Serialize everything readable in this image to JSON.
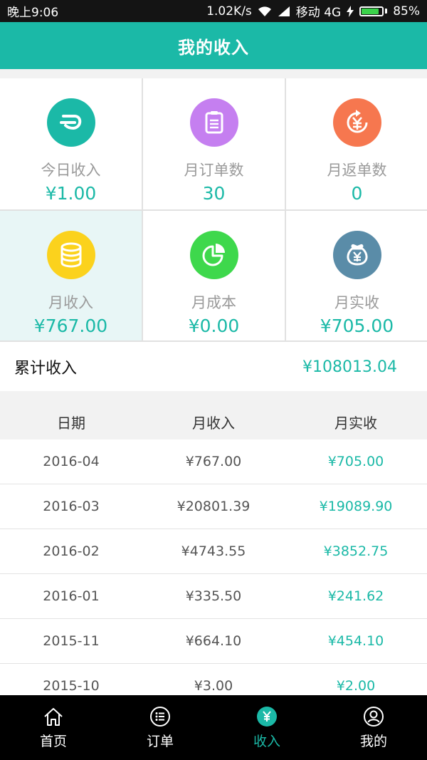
{
  "status_bar": {
    "time": "晚上9:06",
    "speed": "1.02K/s",
    "carrier": "移动 4G",
    "battery": "85%",
    "battery_level": 0.85
  },
  "header": {
    "title": "我的收入"
  },
  "stats": [
    {
      "label": "今日收入",
      "value": "¥1.00",
      "icon": "income-today-icon",
      "color": "#1bb9a7"
    },
    {
      "label": "月订单数",
      "value": "30",
      "icon": "clipboard-icon",
      "color": "#c57ff0"
    },
    {
      "label": "月返单数",
      "value": "0",
      "icon": "refund-yen-icon",
      "color": "#f6774f"
    },
    {
      "label": "月收入",
      "value": "¥767.00",
      "icon": "coins-icon",
      "color": "#fbd21d"
    },
    {
      "label": "月成本",
      "value": "¥0.00",
      "icon": "pie-chart-icon",
      "color": "#3ed84c"
    },
    {
      "label": "月实收",
      "value": "¥705.00",
      "icon": "money-bag-icon",
      "color": "#5a8ca8"
    }
  ],
  "selected_stat": "月收入",
  "total": {
    "label": "累计收入",
    "value": "¥108013.04"
  },
  "table": {
    "headers": [
      "日期",
      "月收入",
      "月实收"
    ],
    "rows": [
      [
        "2016-04",
        "¥767.00",
        "¥705.00"
      ],
      [
        "2016-03",
        "¥20801.39",
        "¥19089.90"
      ],
      [
        "2016-02",
        "¥4743.55",
        "¥3852.75"
      ],
      [
        "2016-01",
        "¥335.50",
        "¥241.62"
      ],
      [
        "2015-11",
        "¥664.10",
        "¥454.10"
      ],
      [
        "2015-10",
        "¥3.00",
        "¥2.00"
      ]
    ]
  },
  "tabs": [
    {
      "label": "首页",
      "icon": "home-icon"
    },
    {
      "label": "订单",
      "icon": "order-list-icon"
    },
    {
      "label": "收入",
      "icon": "yen-icon",
      "active": true
    },
    {
      "label": "我的",
      "icon": "user-icon"
    }
  ],
  "colors": {
    "accent": "#1bb9a7",
    "selected_cell_bg": "#e8f6f6"
  }
}
